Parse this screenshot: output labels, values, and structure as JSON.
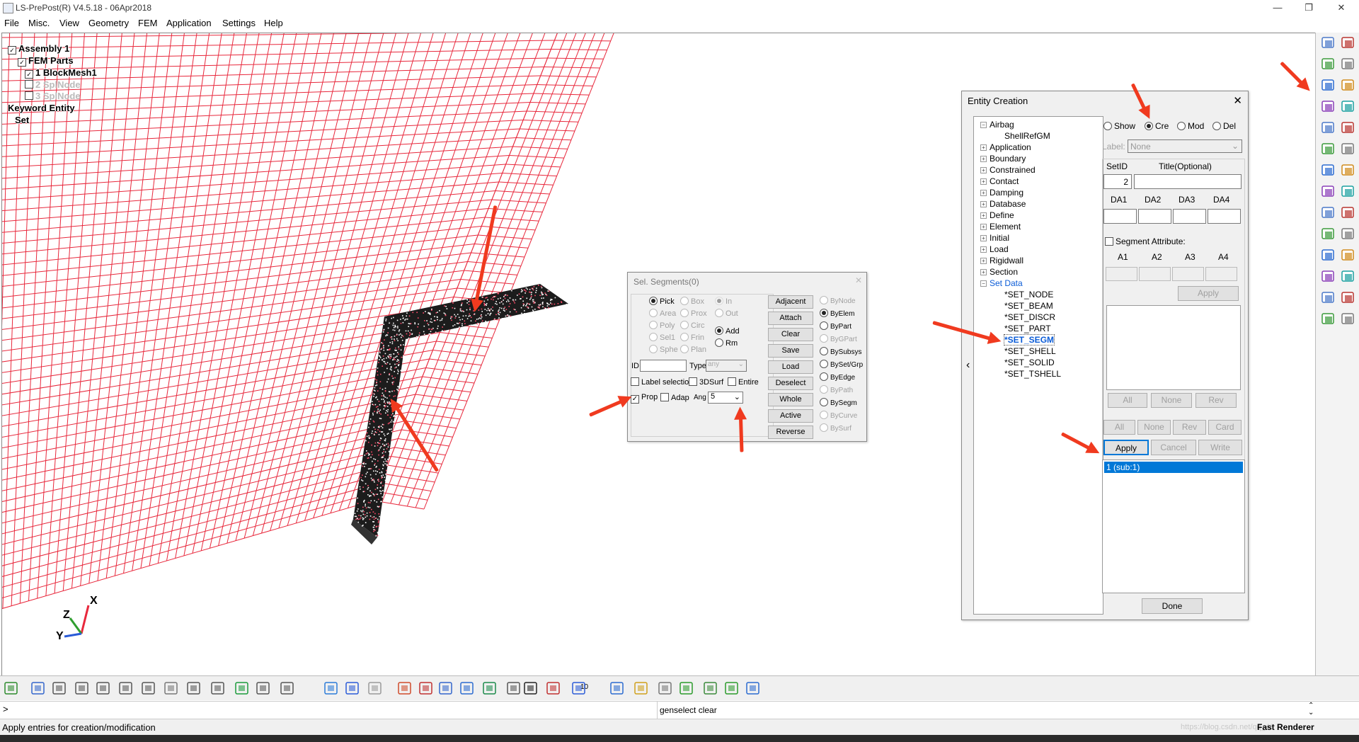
{
  "window": {
    "title": "LS-PrePost(R) V4.5.18 - 06Apr2018",
    "minimize": "—",
    "maximize": "❐",
    "close": "✕"
  },
  "menu": [
    "File",
    "Misc.",
    "View",
    "Geometry",
    "FEM",
    "Application",
    "Settings",
    "Help"
  ],
  "tree": {
    "assembly": "Assembly 1",
    "fem_parts": "FEM Parts",
    "block_mesh": "1 BlockMesh1",
    "spl_node": "2 SplNode",
    "spl_node2": "3 SplNode",
    "keyword_entity": "Keyword Entity",
    "set": "Set"
  },
  "axes": {
    "x": "X",
    "y": "Y",
    "z": "Z"
  },
  "sel_segments": {
    "title": "Sel. Segments(0)",
    "pick_modes": [
      {
        "label": "Pick",
        "selected": true,
        "enabled": true
      },
      {
        "label": "Area",
        "selected": false,
        "enabled": false
      },
      {
        "label": "Poly",
        "selected": false,
        "enabled": false
      },
      {
        "label": "Sel1",
        "selected": false,
        "enabled": false
      },
      {
        "label": "Sphe",
        "selected": false,
        "enabled": false
      }
    ],
    "pick_modes2": [
      {
        "label": "Box",
        "enabled": false
      },
      {
        "label": "Prox",
        "enabled": false
      },
      {
        "label": "Circ",
        "enabled": false
      },
      {
        "label": "Frin",
        "enabled": false
      },
      {
        "label": "Plan",
        "enabled": false
      }
    ],
    "inout": [
      {
        "label": "In",
        "enabled": false
      },
      {
        "label": "Out",
        "enabled": false
      }
    ],
    "addrm": [
      {
        "label": "Add",
        "selected": true
      },
      {
        "label": "Rm",
        "selected": false
      }
    ],
    "id_label": "ID",
    "type_label": "Type",
    "type_value": "any",
    "label_selection": "Label selection",
    "surf3d": "3DSurf",
    "entire": "Entire",
    "prop": "Prop",
    "adap": "Adap",
    "ang_label": "Ang",
    "ang_value": "5",
    "buttons": [
      "Adjacent",
      "Attach",
      "Clear",
      "Save",
      "Load",
      "Deselect",
      "Whole",
      "Active",
      "Reverse"
    ],
    "by_options": [
      {
        "label": "ByNode",
        "selected": false,
        "enabled": false
      },
      {
        "label": "ByElem",
        "selected": true,
        "enabled": true
      },
      {
        "label": "ByPart",
        "selected": false,
        "enabled": true
      },
      {
        "label": "ByGPart",
        "selected": false,
        "enabled": false
      },
      {
        "label": "BySubsys",
        "selected": false,
        "enabled": true
      },
      {
        "label": "BySet/Grp",
        "selected": false,
        "enabled": true
      },
      {
        "label": "ByEdge",
        "selected": false,
        "enabled": true
      },
      {
        "label": "ByPath",
        "selected": false,
        "enabled": false
      },
      {
        "label": "BySegm",
        "selected": false,
        "enabled": true
      },
      {
        "label": "ByCurve",
        "selected": false,
        "enabled": false
      },
      {
        "label": "BySurf",
        "selected": false,
        "enabled": false
      }
    ]
  },
  "entity_creation": {
    "title": "Entity Creation",
    "close": "✕",
    "tree": [
      {
        "label": "Airbag",
        "kind": "minus"
      },
      {
        "label": "ShellRefGM",
        "kind": "child"
      },
      {
        "label": "Application",
        "kind": "plus"
      },
      {
        "label": "Boundary",
        "kind": "plus"
      },
      {
        "label": "Constrained",
        "kind": "plus"
      },
      {
        "label": "Contact",
        "kind": "plus"
      },
      {
        "label": "Damping",
        "kind": "plus"
      },
      {
        "label": "Database",
        "kind": "plus"
      },
      {
        "label": "Define",
        "kind": "plus"
      },
      {
        "label": "Element",
        "kind": "plus"
      },
      {
        "label": "Initial",
        "kind": "plus"
      },
      {
        "label": "Load",
        "kind": "plus"
      },
      {
        "label": "Rigidwall",
        "kind": "plus"
      },
      {
        "label": "Section",
        "kind": "plus"
      },
      {
        "label": "Set Data",
        "kind": "minus-blue"
      },
      {
        "label": "*SET_NODE",
        "kind": "child"
      },
      {
        "label": "*SET_BEAM",
        "kind": "child"
      },
      {
        "label": "*SET_DISCR",
        "kind": "child"
      },
      {
        "label": "*SET_PART",
        "kind": "child"
      },
      {
        "label": "*SET_SEGM",
        "kind": "child-selected"
      },
      {
        "label": "*SET_SHELL",
        "kind": "child"
      },
      {
        "label": "*SET_SOLID",
        "kind": "child"
      },
      {
        "label": "*SET_TSHELL",
        "kind": "child"
      }
    ],
    "modes": [
      {
        "label": "Show",
        "selected": false
      },
      {
        "label": "Cre",
        "selected": true
      },
      {
        "label": "Mod",
        "selected": false
      },
      {
        "label": "Del",
        "selected": false
      }
    ],
    "label_caption": "Label:",
    "label_value": "None",
    "setid_label": "SetID",
    "title_label": "Title(Optional)",
    "setid_value": "2",
    "da_labels": [
      "DA1",
      "DA2",
      "DA3",
      "DA4"
    ],
    "segment_attribute": "Segment Attribute:",
    "a_labels": [
      "A1",
      "A2",
      "A3",
      "A4"
    ],
    "attr_apply": "Apply",
    "list_buttons1": [
      "All",
      "None",
      "Rev"
    ],
    "list_buttons2": [
      "All",
      "None",
      "Rev",
      "Card"
    ],
    "apply": "Apply",
    "cancel": "Cancel",
    "write": "Write",
    "result_item": "1 (sub:1)",
    "done": "Done",
    "collapse_arrow": "‹"
  },
  "command_prompt": ">",
  "command_text": "genselect clear",
  "status_text": "Apply entries for creation/modification",
  "renderer": "Fast Renderer",
  "watermark": "https://blog.csdn.net/qq_43",
  "zoom_value": "10",
  "colors": {
    "mesh": "#e8283c",
    "arrow": "#f03a1f",
    "selection": "#0078d7",
    "link_blue": "#0b5cd7"
  }
}
